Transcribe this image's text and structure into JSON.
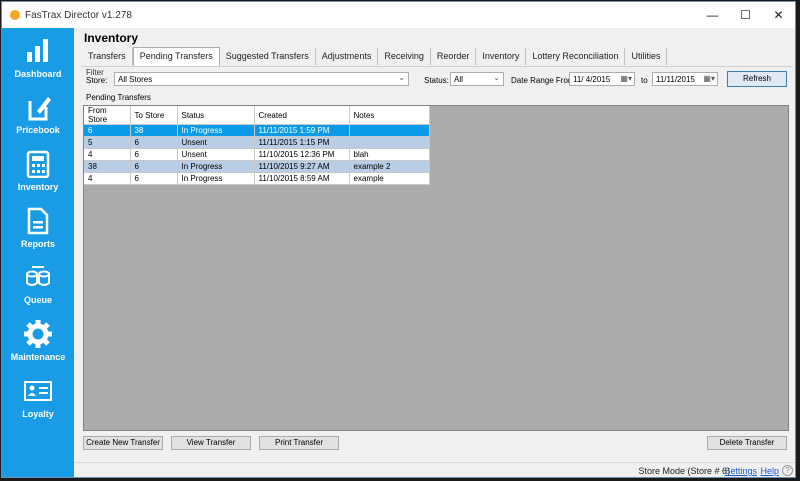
{
  "window": {
    "title": "FasTrax Director v1.278"
  },
  "sidebar": {
    "items": [
      {
        "label": "Dashboard",
        "icon": "bar-chart-icon"
      },
      {
        "label": "Pricebook",
        "icon": "pricebook-icon"
      },
      {
        "label": "Inventory",
        "icon": "calculator-icon"
      },
      {
        "label": "Reports",
        "icon": "document-icon"
      },
      {
        "label": "Queue",
        "icon": "queue-icon"
      },
      {
        "label": "Maintenance",
        "icon": "gear-icon"
      },
      {
        "label": "Loyalty",
        "icon": "id-card-icon"
      }
    ]
  },
  "main": {
    "heading": "Inventory",
    "tabs": [
      "Transfers",
      "Pending Transfers",
      "Suggested Transfers",
      "Adjustments",
      "Receiving",
      "Reorder",
      "Inventory",
      "Lottery Reconciliation",
      "Utilities"
    ],
    "active_tab": "Pending Transfers"
  },
  "filter": {
    "legend": "Filter",
    "store_label": "Store:",
    "store_value": "All Stores",
    "status_label": "Status:",
    "status_value": "All",
    "date_from_label": "Date Range From:",
    "date_from": "11/ 4/2015",
    "to_label": "to",
    "date_to": "11/11/2015",
    "refresh_label": "Refresh"
  },
  "grid": {
    "legend": "Pending Transfers",
    "columns": [
      "From Store",
      "To Store",
      "Status",
      "Created",
      "Notes"
    ],
    "rows": [
      [
        "6",
        "38",
        "In Progress",
        "11/11/2015 1:59 PM",
        ""
      ],
      [
        "5",
        "6",
        "Unsent",
        "11/11/2015 1:15 PM",
        ""
      ],
      [
        "4",
        "6",
        "Unsent",
        "11/10/2015 12:36 PM",
        "blah"
      ],
      [
        "38",
        "6",
        "In Progress",
        "11/10/2015 9:27 AM",
        "example 2"
      ],
      [
        "4",
        "6",
        "In Progress",
        "11/10/2015 8:59 AM",
        "example"
      ]
    ]
  },
  "buttons": {
    "create": "Create New Transfer",
    "view": "View Transfer",
    "print": "Print Transfer",
    "delete": "Delete Transfer"
  },
  "statusbar": {
    "mode": "Store Mode (Store # 6)",
    "settings": "Settings",
    "help": "Help"
  },
  "colors": {
    "sidebar": "#1a9be6",
    "selection": "#0a9ae8",
    "alt_row": "#b8cde6"
  }
}
